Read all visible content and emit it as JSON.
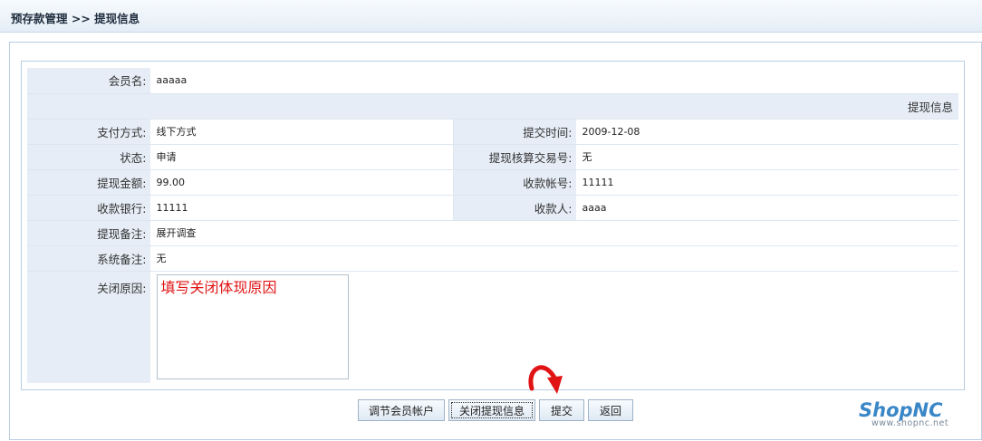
{
  "header": {
    "title": "预存款管理 >> 提现信息"
  },
  "form": {
    "member_label": "会员名:",
    "member_value": "aaaaa",
    "section_title": "提现信息",
    "payment_method_label": "支付方式:",
    "payment_method_value": "线下方式",
    "submit_time_label": "提交时间:",
    "submit_time_value": "2009-12-08",
    "status_label": "状态:",
    "status_value": "申请",
    "transaction_no_label": "提现核算交易号:",
    "transaction_no_value": "无",
    "amount_label": "提现金额:",
    "amount_value": "99.00",
    "account_label": "收款帐号:",
    "account_value": "11111",
    "bank_label": "收款银行:",
    "bank_value": "11111",
    "payee_label": "收款人:",
    "payee_value": "aaaa",
    "remark_label": "提现备注:",
    "remark_value": "展开调查",
    "system_remark_label": "系统备注:",
    "system_remark_value": "无",
    "close_reason_label": "关闭原因:",
    "close_reason_value": "填写关闭体现原因"
  },
  "buttons": {
    "adjust_account": "调节会员帐户",
    "close_withdraw": "关闭提现信息",
    "submit": "提交",
    "back": "返回"
  },
  "logo": {
    "main": "ShopNC",
    "sub": "www.shopnc.net"
  },
  "colors": {
    "annotation_arrow": "#e01414",
    "hint_text": "#e01414",
    "label_bg": "#e6edf6",
    "logo_blue": "#3a87c7"
  }
}
